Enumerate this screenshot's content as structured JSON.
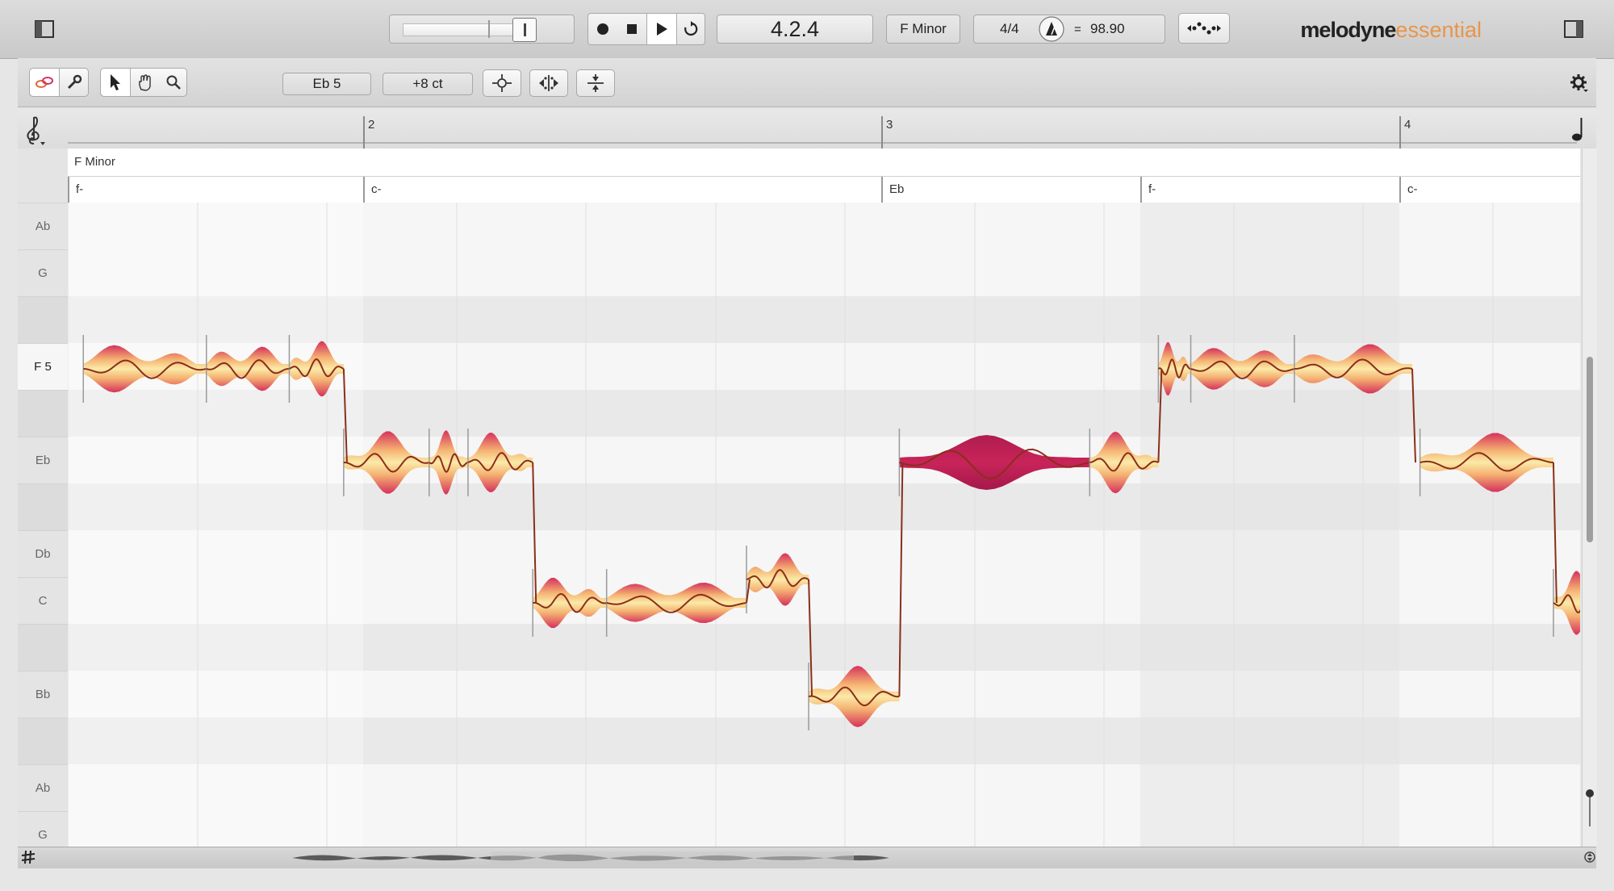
{
  "transport": {
    "position": "4.2.4",
    "key": "F Minor",
    "time_signature": "4/4",
    "tempo_separator": "=",
    "tempo": "98.90"
  },
  "brand": {
    "name": "melodyne",
    "edition": "essential",
    "edition_color": "#e8954a"
  },
  "tools": {
    "pitch_display": "Eb 5",
    "cents_display": "+8 ct"
  },
  "ruler": {
    "bars": [
      "2",
      "3",
      "4"
    ]
  },
  "scale": {
    "key_label": "F Minor"
  },
  "chords": [
    "f-",
    "c-",
    "Eb",
    "f-",
    "c-"
  ],
  "pitch_rows": [
    "Ab",
    "G",
    "",
    "F 5",
    "",
    "Eb",
    "",
    "Db",
    "C",
    "",
    "Bb",
    "",
    "Ab",
    "G"
  ],
  "icons": {
    "sidebar_toggle_left": "sidebar-left-icon",
    "sidebar_toggle_right": "sidebar-right-icon",
    "record": "record-icon",
    "stop": "stop-icon",
    "play": "play-icon",
    "loop": "loop-icon",
    "tempo_dial": "tempo-dial-icon",
    "macro": "macro-icon",
    "pitch_tool": "pitch-tool-icon",
    "main_tool": "wrench-icon",
    "select": "pointer-icon",
    "scroll": "hand-icon",
    "zoom": "zoom-icon",
    "settings": "gear-icon",
    "clef": "treble-clef-icon",
    "note": "note-icon",
    "scale_snap": "sharp-icon"
  },
  "colors": {
    "blob_light": "#fbeaa8",
    "blob_mid": "#f5b272",
    "blob_dark": "#d5325c",
    "blob_selected": "#c8245a",
    "pitch_line": "#8a2f1a"
  },
  "notes": [
    {
      "row": 3,
      "start": 0.12,
      "len": 0.95,
      "selected": false
    },
    {
      "row": 3,
      "start": 1.07,
      "len": 0.64,
      "selected": false
    },
    {
      "row": 3,
      "start": 1.71,
      "len": 0.42,
      "selected": false
    },
    {
      "row": 5,
      "start": 2.13,
      "len": 0.66,
      "selected": false
    },
    {
      "row": 5,
      "start": 2.79,
      "len": 0.3,
      "selected": false
    },
    {
      "row": 5,
      "start": 3.09,
      "len": 0.5,
      "selected": false
    },
    {
      "row": 8,
      "start": 3.59,
      "len": 0.57,
      "selected": false
    },
    {
      "row": 8,
      "start": 4.16,
      "len": 1.08,
      "selected": false
    },
    {
      "row": 7.5,
      "start": 5.24,
      "len": 0.48,
      "selected": false
    },
    {
      "row": 10,
      "start": 5.72,
      "len": 0.7,
      "selected": false
    },
    {
      "row": 5,
      "start": 6.42,
      "len": 1.47,
      "selected": true
    },
    {
      "row": 5,
      "start": 7.89,
      "len": 0.53,
      "selected": false
    },
    {
      "row": 3,
      "start": 8.42,
      "len": 0.25,
      "selected": false
    },
    {
      "row": 3,
      "start": 8.67,
      "len": 0.8,
      "selected": false
    },
    {
      "row": 3,
      "start": 9.47,
      "len": 0.91,
      "selected": false
    },
    {
      "row": 5,
      "start": 10.44,
      "len": 1.03,
      "selected": false
    },
    {
      "row": 8,
      "start": 11.47,
      "len": 0.37,
      "selected": false
    }
  ]
}
